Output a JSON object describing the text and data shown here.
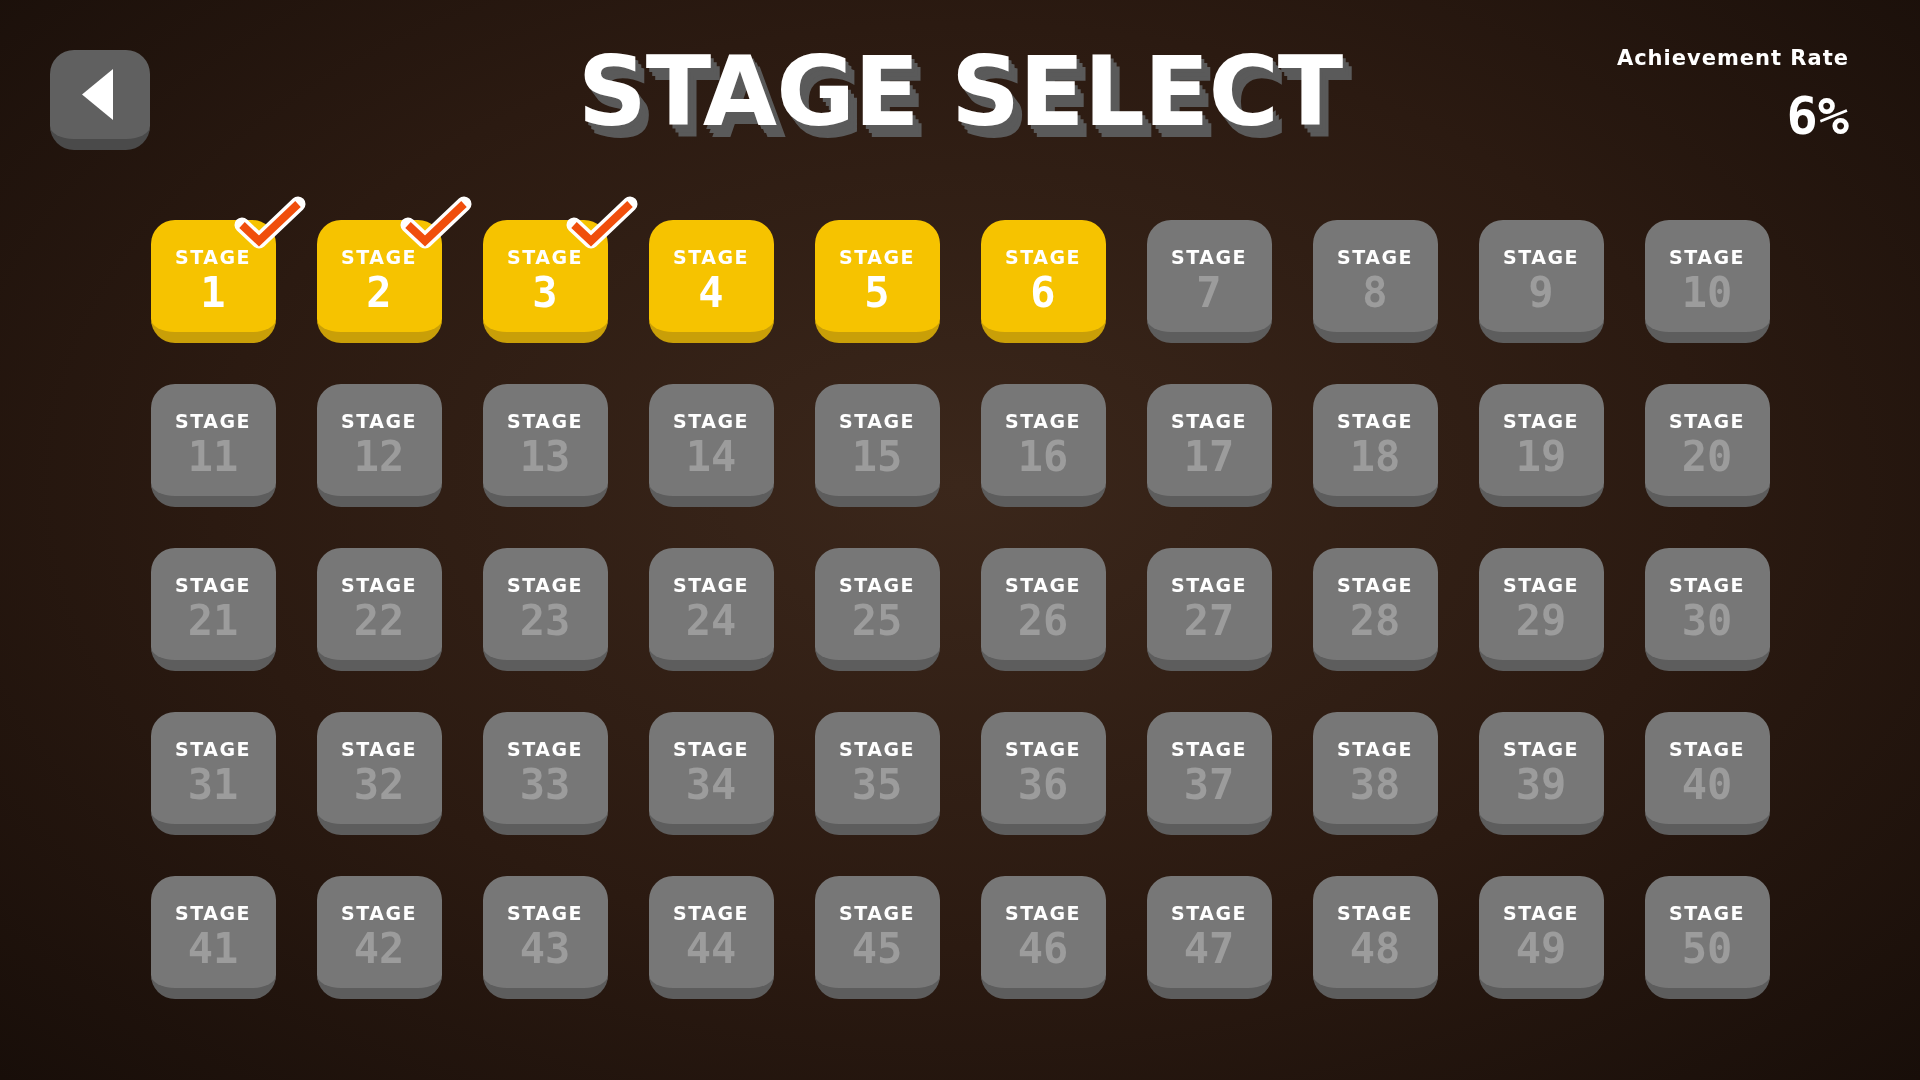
{
  "title": "STAGE SELECT",
  "achievement": {
    "label": "Achievement Rate",
    "value": "6%"
  },
  "stages": [
    {
      "label": "STAGE",
      "number": "1",
      "unlocked": true,
      "cleared": true
    },
    {
      "label": "STAGE",
      "number": "2",
      "unlocked": true,
      "cleared": true
    },
    {
      "label": "STAGE",
      "number": "3",
      "unlocked": true,
      "cleared": true
    },
    {
      "label": "STAGE",
      "number": "4",
      "unlocked": true,
      "cleared": false
    },
    {
      "label": "STAGE",
      "number": "5",
      "unlocked": true,
      "cleared": false
    },
    {
      "label": "STAGE",
      "number": "6",
      "unlocked": true,
      "cleared": false
    },
    {
      "label": "STAGE",
      "number": "7",
      "unlocked": false,
      "cleared": false
    },
    {
      "label": "STAGE",
      "number": "8",
      "unlocked": false,
      "cleared": false
    },
    {
      "label": "STAGE",
      "number": "9",
      "unlocked": false,
      "cleared": false
    },
    {
      "label": "STAGE",
      "number": "10",
      "unlocked": false,
      "cleared": false
    },
    {
      "label": "STAGE",
      "number": "11",
      "unlocked": false,
      "cleared": false
    },
    {
      "label": "STAGE",
      "number": "12",
      "unlocked": false,
      "cleared": false
    },
    {
      "label": "STAGE",
      "number": "13",
      "unlocked": false,
      "cleared": false
    },
    {
      "label": "STAGE",
      "number": "14",
      "unlocked": false,
      "cleared": false
    },
    {
      "label": "STAGE",
      "number": "15",
      "unlocked": false,
      "cleared": false
    },
    {
      "label": "STAGE",
      "number": "16",
      "unlocked": false,
      "cleared": false
    },
    {
      "label": "STAGE",
      "number": "17",
      "unlocked": false,
      "cleared": false
    },
    {
      "label": "STAGE",
      "number": "18",
      "unlocked": false,
      "cleared": false
    },
    {
      "label": "STAGE",
      "number": "19",
      "unlocked": false,
      "cleared": false
    },
    {
      "label": "STAGE",
      "number": "20",
      "unlocked": false,
      "cleared": false
    },
    {
      "label": "STAGE",
      "number": "21",
      "unlocked": false,
      "cleared": false
    },
    {
      "label": "STAGE",
      "number": "22",
      "unlocked": false,
      "cleared": false
    },
    {
      "label": "STAGE",
      "number": "23",
      "unlocked": false,
      "cleared": false
    },
    {
      "label": "STAGE",
      "number": "24",
      "unlocked": false,
      "cleared": false
    },
    {
      "label": "STAGE",
      "number": "25",
      "unlocked": false,
      "cleared": false
    },
    {
      "label": "STAGE",
      "number": "26",
      "unlocked": false,
      "cleared": false
    },
    {
      "label": "STAGE",
      "number": "27",
      "unlocked": false,
      "cleared": false
    },
    {
      "label": "STAGE",
      "number": "28",
      "unlocked": false,
      "cleared": false
    },
    {
      "label": "STAGE",
      "number": "29",
      "unlocked": false,
      "cleared": false
    },
    {
      "label": "STAGE",
      "number": "30",
      "unlocked": false,
      "cleared": false
    },
    {
      "label": "STAGE",
      "number": "31",
      "unlocked": false,
      "cleared": false
    },
    {
      "label": "STAGE",
      "number": "32",
      "unlocked": false,
      "cleared": false
    },
    {
      "label": "STAGE",
      "number": "33",
      "unlocked": false,
      "cleared": false
    },
    {
      "label": "STAGE",
      "number": "34",
      "unlocked": false,
      "cleared": false
    },
    {
      "label": "STAGE",
      "number": "35",
      "unlocked": false,
      "cleared": false
    },
    {
      "label": "STAGE",
      "number": "36",
      "unlocked": false,
      "cleared": false
    },
    {
      "label": "STAGE",
      "number": "37",
      "unlocked": false,
      "cleared": false
    },
    {
      "label": "STAGE",
      "number": "38",
      "unlocked": false,
      "cleared": false
    },
    {
      "label": "STAGE",
      "number": "39",
      "unlocked": false,
      "cleared": false
    },
    {
      "label": "STAGE",
      "number": "40",
      "unlocked": false,
      "cleared": false
    },
    {
      "label": "STAGE",
      "number": "41",
      "unlocked": false,
      "cleared": false
    },
    {
      "label": "STAGE",
      "number": "42",
      "unlocked": false,
      "cleared": false
    },
    {
      "label": "STAGE",
      "number": "43",
      "unlocked": false,
      "cleared": false
    },
    {
      "label": "STAGE",
      "number": "44",
      "unlocked": false,
      "cleared": false
    },
    {
      "label": "STAGE",
      "number": "45",
      "unlocked": false,
      "cleared": false
    },
    {
      "label": "STAGE",
      "number": "46",
      "unlocked": false,
      "cleared": false
    },
    {
      "label": "STAGE",
      "number": "47",
      "unlocked": false,
      "cleared": false
    },
    {
      "label": "STAGE",
      "number": "48",
      "unlocked": false,
      "cleared": false
    },
    {
      "label": "STAGE",
      "number": "49",
      "unlocked": false,
      "cleared": false
    },
    {
      "label": "STAGE",
      "number": "50",
      "unlocked": false,
      "cleared": false
    }
  ]
}
